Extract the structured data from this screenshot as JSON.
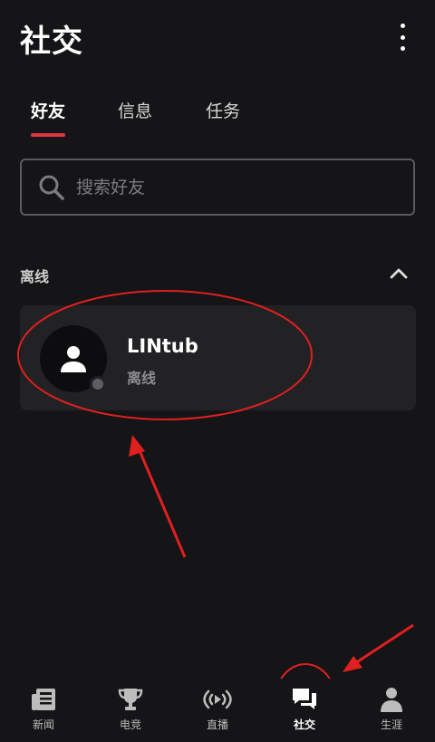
{
  "header": {
    "title": "社交"
  },
  "tabs": [
    {
      "label": "好友",
      "active": true
    },
    {
      "label": "信息",
      "active": false
    },
    {
      "label": "任务",
      "active": false
    }
  ],
  "search": {
    "placeholder": "搜索好友",
    "value": ""
  },
  "section": {
    "title": "离线",
    "expanded": true
  },
  "friends": [
    {
      "name": "LINtub",
      "status": "离线"
    }
  ],
  "bottom_nav": [
    {
      "label": "新闻",
      "icon": "news-icon"
    },
    {
      "label": "电竞",
      "icon": "trophy-icon"
    },
    {
      "label": "直播",
      "icon": "live-broadcast-icon"
    },
    {
      "label": "社交",
      "icon": "chat-bubbles-icon",
      "active": true
    },
    {
      "label": "生涯",
      "icon": "person-icon"
    }
  ],
  "colors": {
    "background": "#151416",
    "card": "#222124",
    "accent": "#e0353f",
    "annotation": "#e02020"
  }
}
